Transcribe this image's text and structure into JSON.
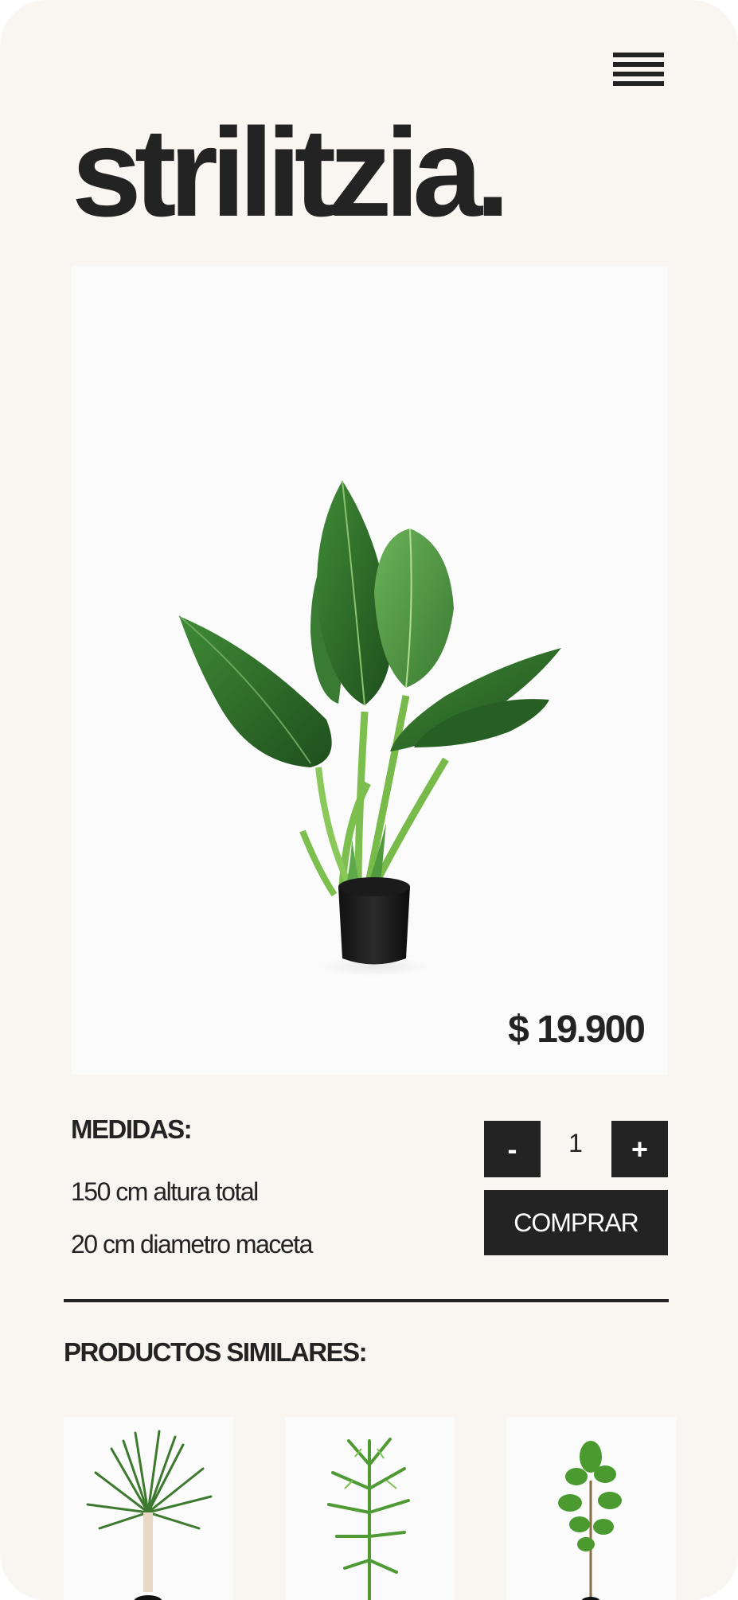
{
  "header": {
    "menu_icon": "hamburger-menu-icon"
  },
  "product": {
    "title": "strilitzia.",
    "price": "$ 19.900",
    "image_icon": "plant-photo"
  },
  "details": {
    "medidas_label": "MEDIDAS:",
    "height": "150 cm altura total",
    "diameter": "20 cm diametro maceta"
  },
  "purchase": {
    "minus_label": "-",
    "quantity": "1",
    "plus_label": "+",
    "buy_label": "COMPRAR"
  },
  "similar": {
    "title": "PRODUCTOS SIMILARES:",
    "items": [
      {
        "image_icon": "plant-photo"
      },
      {
        "image_icon": "plant-photo"
      },
      {
        "image_icon": "plant-photo"
      }
    ]
  },
  "colors": {
    "background": "#f9f6f2",
    "dark": "#232323",
    "image_bg": "#fbfbfb",
    "leaf_green": "#2f6b2a"
  }
}
